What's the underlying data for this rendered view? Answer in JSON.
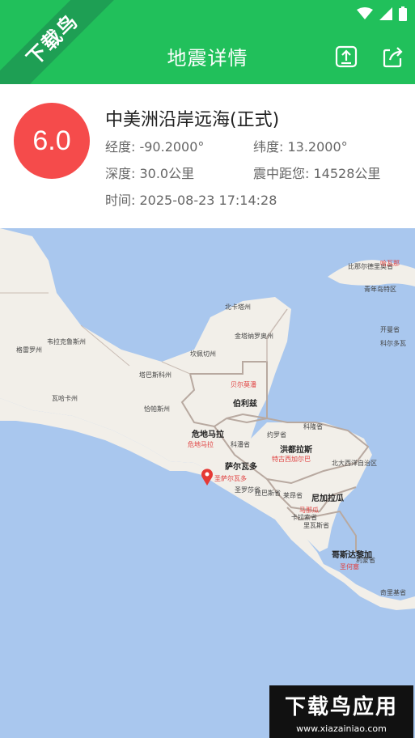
{
  "app_bar": {
    "title": "地震详情",
    "watermark": "下载鸟"
  },
  "quake": {
    "magnitude": "6.0",
    "title": "中美洲沿岸远海(正式)",
    "longitude": "经度: -90.2000°",
    "latitude": "纬度: 13.2000°",
    "depth": "深度: 30.0公里",
    "distance": "震中距您: 14528公里",
    "time": "时间: 2025-08-23 17:14:28"
  },
  "map": {
    "labels": [
      {
        "text": "北卡塔州",
        "cls": ""
      },
      {
        "text": "金塔纳罗奥州",
        "cls": ""
      },
      {
        "text": "坎佩切州",
        "cls": ""
      },
      {
        "text": "塔巴斯科州",
        "cls": ""
      },
      {
        "text": "恰帕斯州",
        "cls": ""
      },
      {
        "text": "瓦哈卡州",
        "cls": ""
      },
      {
        "text": "韦拉克鲁斯州",
        "cls": ""
      },
      {
        "text": "格雷罗州",
        "cls": ""
      },
      {
        "text": "伯利兹",
        "cls": "bold"
      },
      {
        "text": "贝尔莫潘",
        "cls": "red"
      },
      {
        "text": "危地马拉",
        "cls": "bold"
      },
      {
        "text": "危地马拉",
        "cls": "red"
      },
      {
        "text": "洪都拉斯",
        "cls": "bold"
      },
      {
        "text": "特古西加尔巴",
        "cls": "red"
      },
      {
        "text": "萨尔瓦多",
        "cls": "bold"
      },
      {
        "text": "圣萨尔瓦多",
        "cls": "red"
      },
      {
        "text": "尼加拉瓜",
        "cls": "bold"
      },
      {
        "text": "马那瓜",
        "cls": "red"
      },
      {
        "text": "哥斯达黎加",
        "cls": "bold"
      },
      {
        "text": "圣何塞",
        "cls": "red"
      },
      {
        "text": "北大西洋自治区",
        "cls": ""
      },
      {
        "text": "科隆省",
        "cls": ""
      },
      {
        "text": "约罗省",
        "cls": ""
      },
      {
        "text": "科潘省",
        "cls": ""
      },
      {
        "text": "拉巴斯省",
        "cls": ""
      },
      {
        "text": "圣罗莎省",
        "cls": ""
      },
      {
        "text": "莱昂省",
        "cls": ""
      },
      {
        "text": "卡拉索省",
        "cls": ""
      },
      {
        "text": "里瓦斯省",
        "cls": ""
      },
      {
        "text": "利蒙省",
        "cls": ""
      },
      {
        "text": "奇里基省",
        "cls": ""
      },
      {
        "text": "比那尔德里奥省",
        "cls": ""
      },
      {
        "text": "哈瓦那",
        "cls": "red"
      },
      {
        "text": "青年岛特区",
        "cls": ""
      },
      {
        "text": "科尔多瓦",
        "cls": ""
      },
      {
        "text": "开曼省",
        "cls": ""
      }
    ]
  },
  "footer_logo": {
    "main": "下载鸟应用",
    "url": "www.xiazainiao.com"
  }
}
